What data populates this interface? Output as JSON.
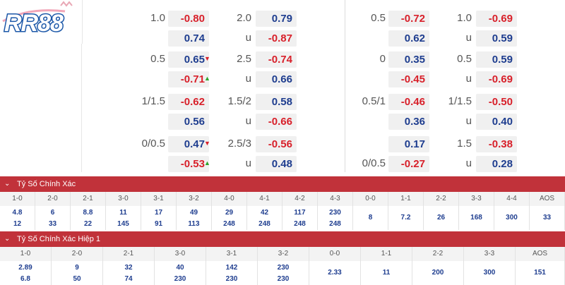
{
  "brand": {
    "logo_text": "RR88"
  },
  "odds_left": [
    {
      "h1": "1.0",
      "v1a": "-0.80",
      "v1b": "0.74",
      "h2": "2.0",
      "v2a": "0.79",
      "h2b": "u",
      "v2b": "-0.87"
    },
    {
      "h1": "0.5",
      "v1a": "0.65",
      "v1b": "-0.71",
      "h2": "2.5",
      "v2a": "-0.74",
      "h2b": "u",
      "v2b": "0.66"
    },
    {
      "h1": "1/1.5",
      "v1a": "-0.62",
      "v1b": "0.56",
      "h2": "1.5/2",
      "v2a": "0.58",
      "h2b": "u",
      "v2b": "-0.66"
    },
    {
      "h1": "0/0.5",
      "v1a": "0.47",
      "v1b": "-0.53",
      "h2": "2.5/3",
      "v2a": "-0.56",
      "h2b": "u",
      "v2b": "0.48"
    }
  ],
  "odds_right": [
    {
      "h1": "0.5",
      "v1a": "-0.72",
      "h1b": "",
      "v1b": "0.62",
      "h2": "1.0",
      "v2a": "-0.69",
      "h2b": "u",
      "v2b": "0.59"
    },
    {
      "h1": "0",
      "v1a": "0.35",
      "h1b": "",
      "v1b": "-0.45",
      "h2": "0.5",
      "v2a": "0.59",
      "h2b": "u",
      "v2b": "-0.69"
    },
    {
      "h1": "0.5/1",
      "v1a": "-0.46",
      "h1b": "",
      "v1b": "0.36",
      "h2": "1/1.5",
      "v2a": "-0.50",
      "h2b": "u",
      "v2b": "0.40"
    },
    {
      "h1": "",
      "v1a": "0.17",
      "h1b": "0/0.5",
      "v1b": "-0.27",
      "h2": "1.5",
      "v2a": "-0.38",
      "h2b": "u",
      "v2b": "0.28"
    }
  ],
  "section1": {
    "title": "Tỷ Số Chính Xác",
    "headers": [
      "1-0",
      "2-0",
      "2-1",
      "3-0",
      "3-1",
      "3-2",
      "4-0",
      "4-1",
      "4-2",
      "4-3",
      "0-0",
      "1-1",
      "2-2",
      "3-3",
      "4-4",
      "AOS"
    ],
    "top": [
      "4.8",
      "6",
      "8.8",
      "11",
      "17",
      "49",
      "29",
      "42",
      "117",
      "230",
      "",
      "",
      "",
      "",
      "",
      ""
    ],
    "bottom": [
      "12",
      "33",
      "22",
      "145",
      "91",
      "113",
      "248",
      "248",
      "248",
      "248",
      "",
      "",
      "",
      "",
      "",
      ""
    ],
    "single": [
      "",
      "",
      "",
      "",
      "",
      "",
      "",
      "",
      "",
      "",
      "8",
      "7.2",
      "26",
      "168",
      "300",
      "33"
    ]
  },
  "section2": {
    "title": "Tỷ Số Chính Xác Hiệp 1",
    "headers": [
      "1-0",
      "2-0",
      "2-1",
      "3-0",
      "3-1",
      "3-2",
      "0-0",
      "1-1",
      "2-2",
      "3-3",
      "AOS"
    ],
    "top": [
      "2.89",
      "9",
      "32",
      "40",
      "142",
      "230",
      "",
      "",
      "",
      "",
      ""
    ],
    "bottom": [
      "6.8",
      "50",
      "74",
      "230",
      "230",
      "230",
      "",
      "",
      "",
      "",
      ""
    ],
    "single": [
      "",
      "",
      "",
      "",
      "",
      "",
      "2.33",
      "11",
      "200",
      "300",
      "151"
    ]
  },
  "colors": {
    "header_red": "#c1323a",
    "negative": "#d8202a",
    "positive": "#1e3d8f"
  }
}
